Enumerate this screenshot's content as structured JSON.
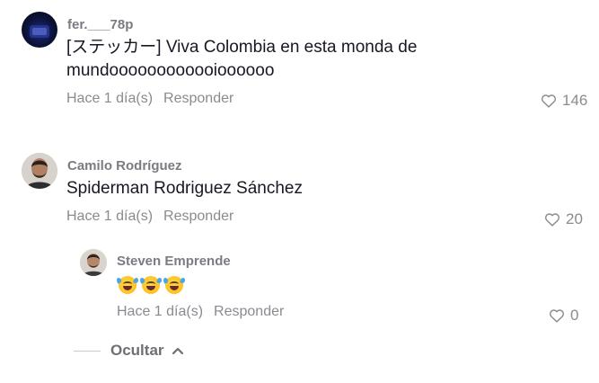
{
  "comments": [
    {
      "username": "fer.___78p",
      "text_line1": "[ステッカー] Viva Colombia en esta monda de",
      "text_line2": "mundoooooooooooioooooo",
      "time": "Hace 1 día(s)",
      "reply_label": "Responder",
      "likes": "146"
    },
    {
      "username": "Camilo Rodríguez",
      "text": "Spiderman Rodriguez Sánchez",
      "time": "Hace 1 día(s)",
      "reply_label": "Responder",
      "likes": "20"
    }
  ],
  "reply": {
    "username": "Steven Emprende",
    "time": "Hace 1 día(s)",
    "reply_label": "Responder",
    "likes": "0"
  },
  "hide_label": "Ocultar",
  "colors": {
    "username": "#7a7c82",
    "meta": "#8a8b91",
    "text": "#161823"
  }
}
